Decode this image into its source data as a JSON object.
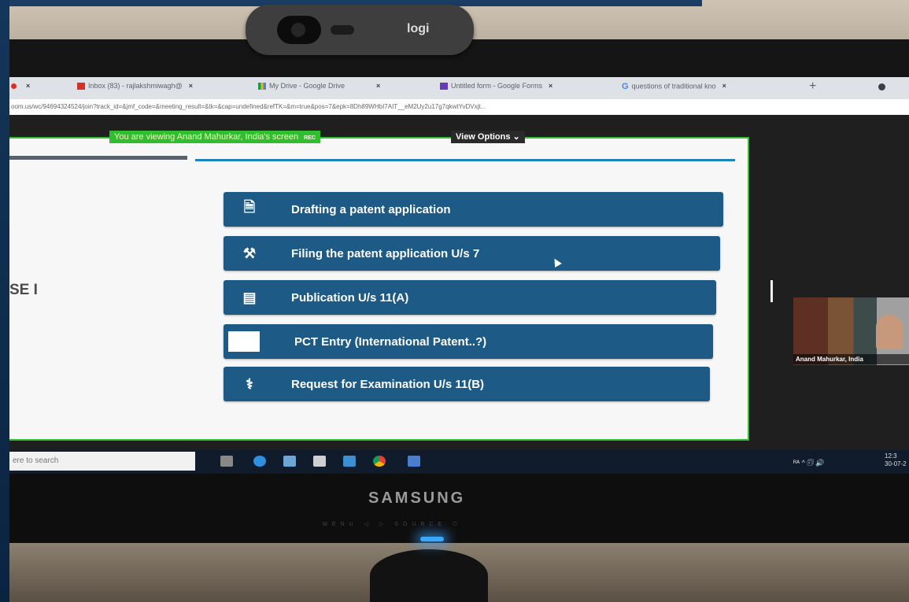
{
  "browser": {
    "tabs": [
      {
        "label": "",
        "icon": "record-icon"
      },
      {
        "label": "Inbox (83) - rajlakshmiwagh@",
        "icon": "gmail-icon"
      },
      {
        "label": "My Drive - Google Drive",
        "icon": "drive-icon"
      },
      {
        "label": "Untitled form - Google Forms",
        "icon": "forms-icon"
      },
      {
        "label": "questions of traditional kno",
        "icon": "google-icon",
        "icon_glyph": "G"
      }
    ],
    "new_tab": "+",
    "close_glyph": "×",
    "url": "oom.us/wc/94694324524/join?track_id=&jmf_code=&meeting_result=&tk=&cap=undefined&refTK=&m=true&pos=7&epk=8Dh89WHbI7AIT__eM2Uy2u17g7qkwtYvDVxjt..."
  },
  "zoom": {
    "banner_text": "You are viewing Anand Mahurkar, India's screen",
    "rec_label": "REC",
    "view_options_label": "View Options ⌄",
    "presenter_name": "Anand Mahurkar, India"
  },
  "slide": {
    "side_label": "SE I",
    "steps": [
      {
        "label": "Drafting a patent application",
        "icon": "document-icon",
        "glyph": "🗎"
      },
      {
        "label": "Filing the patent application U/s 7",
        "icon": "gavel-icon",
        "glyph": "⚒"
      },
      {
        "label": "Publication U/s 11(A)",
        "icon": "newspaper-icon",
        "glyph": "▤"
      },
      {
        "label": "PCT Entry (International Patent..?)",
        "icon": "blank-box-icon",
        "glyph": ""
      },
      {
        "label": "Request for Examination U/s 11(B)",
        "icon": "stethoscope-icon",
        "glyph": "⚕"
      }
    ]
  },
  "taskbar": {
    "search_placeholder": "ere to search",
    "tray_text": "ᴿᴬ  ^  🗊 🔊",
    "time": "12:3",
    "date": "30-07-2"
  },
  "monitor": {
    "webcam_brand": "logi",
    "brand": "SAMSUNG",
    "bezel_buttons": "MENU ◁ ▷ SOURCE ⏻"
  },
  "colors": {
    "step_blue": "#1d5a85",
    "zoom_green": "#30bd30",
    "accent_blue": "#1d82c4"
  }
}
